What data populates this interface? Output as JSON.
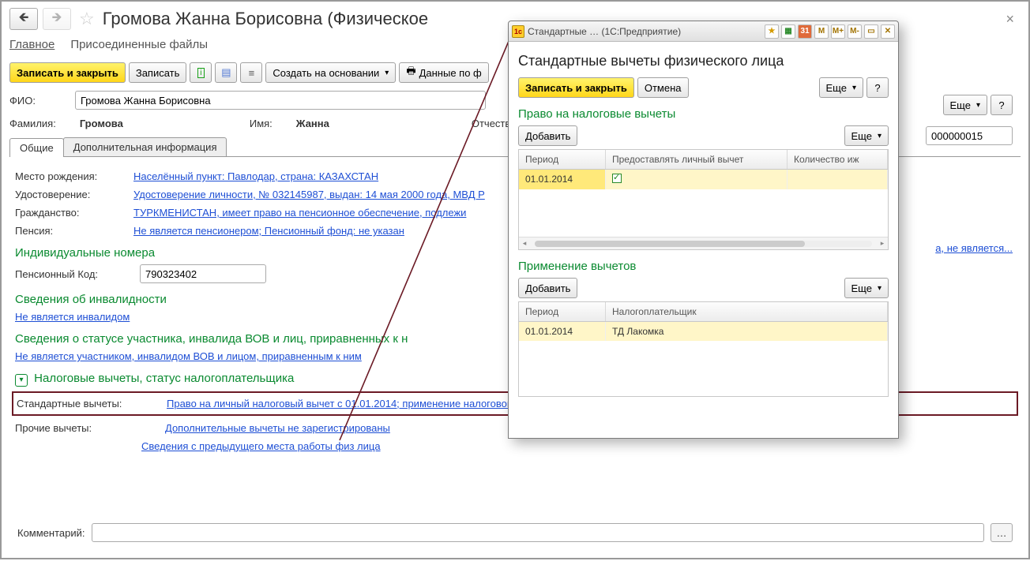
{
  "main": {
    "title": "Громова Жанна Борисовна (Физическое",
    "subnav": {
      "main": "Главное",
      "files": "Присоединенные файлы"
    },
    "toolbar": {
      "save_close": "Записать и закрыть",
      "save": "Записать",
      "create_on_basis": "Создать на основании",
      "data_on": "Данные по ф",
      "more": "Еще",
      "help": "?"
    },
    "fio": {
      "label": "ФИО:",
      "value": "Громова Жанна Борисовна"
    },
    "names": {
      "surname_label": "Фамилия:",
      "surname": "Громова",
      "name_label": "Имя:",
      "name": "Жанна",
      "patronymic_label": "Отчество:"
    },
    "tabs": {
      "common": "Общие",
      "extra": "Дополнительная информация"
    },
    "links": {
      "birthplace_label": "Место рождения:",
      "birthplace": "Населённый пункт: Павлодар, страна: КАЗАХСТАН",
      "id_label": "Удостоверение:",
      "id": "Удостоверение личности, № 032145987, выдан: 14 мая 2000 года, МВД Р",
      "citizenship_label": "Гражданство:",
      "citizenship": "ТУРКМЕНИСТАН, имеет право на пенсионное обеспечение, подлежи",
      "citizenship_tail": "а, не является...",
      "pension_label": "Пенсия:",
      "pension": "Не является пенсионером; Пенсионный фонд: не указан"
    },
    "sect_ids": "Индивидуальные номера",
    "pension_code": {
      "label": "Пенсионный Код:",
      "value": "790323402"
    },
    "sect_disability": "Сведения об инвалидности",
    "disability_link": "Не является инвалидом",
    "sect_vov": "Сведения о статусе участника, инвалида ВОВ и лиц, приравненных к н",
    "vov_link": "Не является участником, инвалидом ВОВ и лицом, приравненным к ним",
    "sect_tax": "Налоговые вычеты, статус налогоплательщика",
    "std_ded_label": "Стандартные вычеты:",
    "std_ded_link": "Право на личный налоговый вычет с 01.01.2014; применение налогового вычета с 01.01.2014, налогоплательщик ТД Лакомка",
    "other_ded_label": "Прочие вычеты:",
    "other_ded_link": "Дополнительные вычеты не зарегистрированы",
    "prev_workplace_link": "Сведения с предыдущего места работы физ лица",
    "comment_label": "Комментарий:",
    "code_value": "000000015"
  },
  "modal": {
    "wintitle": "Стандартные … (1С:Предприятие)",
    "title": "Стандартные вычеты физического лица",
    "toolbar": {
      "save_close": "Записать и закрыть",
      "cancel": "Отмена",
      "more": "Еще",
      "help": "?"
    },
    "sect_right": "Право на налоговые вычеты",
    "add": "Добавить",
    "more": "Еще",
    "grid1": {
      "columns": [
        "Период",
        "Предоставлять личный вычет",
        "Количество иж"
      ],
      "row": {
        "period": "01.01.2014"
      }
    },
    "sect_apply": "Применение вычетов",
    "grid2": {
      "columns": [
        "Период",
        "Налогоплательщик"
      ],
      "row": {
        "period": "01.01.2014",
        "payer": "ТД Лакомка"
      }
    }
  },
  "icons": {
    "M": "M",
    "Mp": "M+",
    "Mm": "M-"
  }
}
